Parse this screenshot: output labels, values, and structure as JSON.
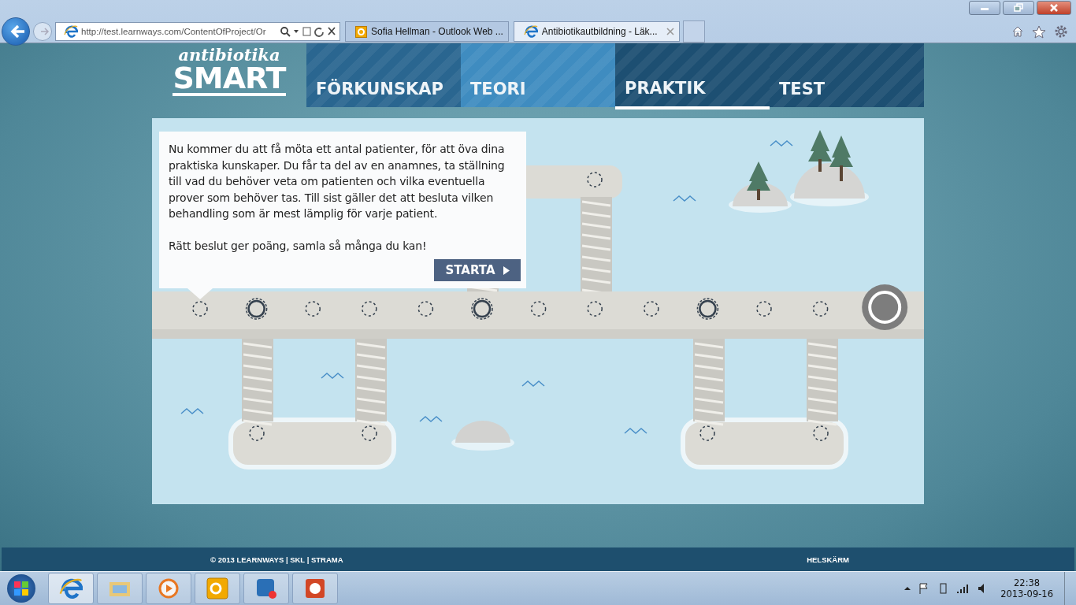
{
  "browser": {
    "address": "http://test.learnways.com/ContentOfProject/Or",
    "tabs": [
      {
        "label": "Sofia Hellman - Outlook Web ...",
        "selected": false
      },
      {
        "label": "Antibiotikautbildning - Läk...",
        "selected": true
      }
    ]
  },
  "logo": {
    "script": "antibiotika",
    "word": "SMART"
  },
  "nav": [
    {
      "label": "FÖRKUNSKAP",
      "color": "#2a6690",
      "selected": false
    },
    {
      "label": "TEORI",
      "color": "#3f8cc0",
      "selected": false
    },
    {
      "label": "PRAKTIK",
      "color": "#1d4f72",
      "selected": true
    },
    {
      "label": "TEST",
      "color": "#1d4f72",
      "selected": false
    }
  ],
  "intro": {
    "paragraphs": [
      "Nu kommer du att få möta ett antal patienter, för att öva dina praktiska kunskaper. Du får ta del av en anamnes, ta ställning till vad du behöver veta om patienten och vilka eventuella prover som behöver tas. Till sist gäller det att besluta vilken behandling som är mest lämplig för varje patient.",
      "Rätt beslut ger poäng, samla så många du kan!"
    ],
    "button": "STARTA"
  },
  "stops": [
    {
      "kind": "open"
    },
    {
      "kind": "ring"
    },
    {
      "kind": "open"
    },
    {
      "kind": "open"
    },
    {
      "kind": "open"
    },
    {
      "kind": "ring"
    },
    {
      "kind": "open"
    },
    {
      "kind": "open"
    },
    {
      "kind": "open"
    },
    {
      "kind": "ring"
    },
    {
      "kind": "open"
    },
    {
      "kind": "open"
    },
    {
      "kind": "goal"
    }
  ],
  "footer": {
    "copyright": "© 2013 LEARNWAYS | SKL | STRAMA",
    "fullscreen": "HELSKÄRM"
  },
  "taskbar": {
    "time": "22:38",
    "date": "2013-09-16"
  }
}
